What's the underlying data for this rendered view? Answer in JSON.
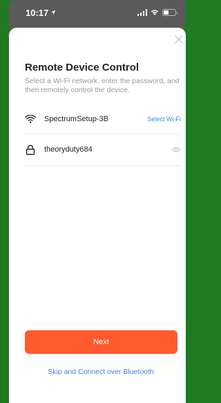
{
  "status_bar": {
    "time": "10:17",
    "battery_level": 0.45
  },
  "sheet": {
    "title": "Remote Device Control",
    "subtitle": "Select a Wi-Fi network, enter the password, and then remotely control the device.",
    "wifi_row": {
      "network_name": "SpectrumSetup-3B",
      "action_label": "Select Wi-Fi"
    },
    "password_row": {
      "value": "theoryduty684"
    },
    "next_label": "Next",
    "bluetooth_link": "Skip and Connect over Bluetooth"
  },
  "colors": {
    "accent": "#ff5a2e",
    "link": "#3b82e6",
    "backdrop": "#1f7a22"
  },
  "icons": {
    "status": [
      "location-arrow-icon",
      "cellular-signal-icon",
      "wifi-icon",
      "battery-icon"
    ],
    "sheet": [
      "close-icon",
      "wifi-icon",
      "lock-icon",
      "eye-icon"
    ]
  }
}
